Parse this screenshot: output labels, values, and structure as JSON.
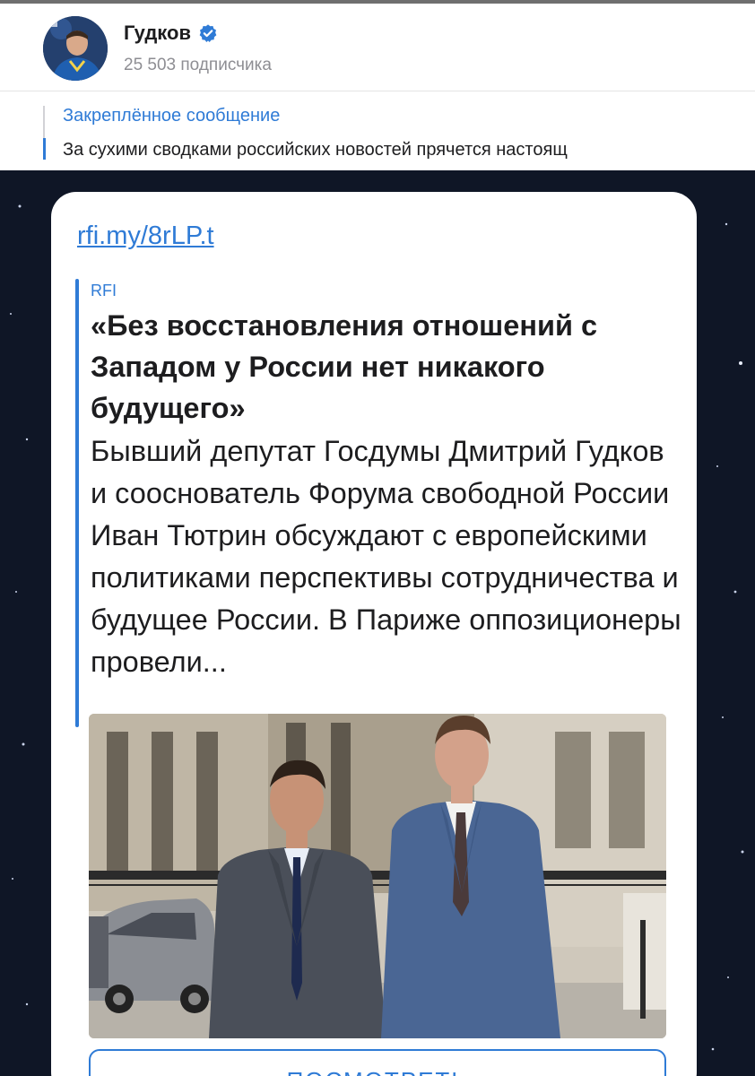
{
  "channel": {
    "name": "Гудков",
    "subscribers": "25 503 подписчика",
    "verified": true,
    "accent_color": "#2f7bd6"
  },
  "pinned": {
    "title": "Закреплённое сообщение",
    "text": "За сухими сводками российских новостей прячется настоящ"
  },
  "post": {
    "link": "rfi.my/8rLP.t",
    "preview": {
      "site": "RFI",
      "title": "«Без восстановления отношений с Западом у России нет никакого будущего»",
      "description": "Бывший депутат Госдумы Дмитрий Гудков и сооснователь Форума свободной России Иван Тютрин обсуждают с европейскими политиками перспективы сотрудничества и будущее России. В Париже оппозиционеры провели..."
    },
    "button_label": "ПОСМОТРЕТЬ"
  }
}
